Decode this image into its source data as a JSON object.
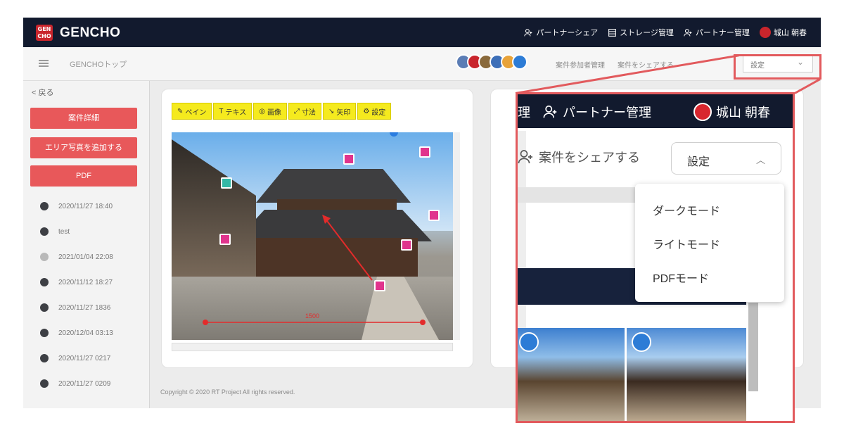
{
  "nav": {
    "logo_box": "GEN CHO",
    "logo_text": "GENCHO",
    "links": [
      {
        "label": "パートナーシェア",
        "icon": "person-add-icon"
      },
      {
        "label": "ストレージ管理",
        "icon": "storage-icon"
      },
      {
        "label": "パートナー管理",
        "icon": "person-add-icon"
      },
      {
        "label": "城山 朝春",
        "icon": "avatar"
      }
    ]
  },
  "subheader": {
    "breadcrumb": "GENCHOトップ",
    "action_participants": "案件参加者管理",
    "action_share": "案件をシェアする",
    "settings_value": "設定"
  },
  "sidebar": {
    "back": "< 戻る",
    "buttons": [
      "案件詳細",
      "エリア写真を追加する",
      "PDF"
    ],
    "items": [
      "2020/11/27 18:40",
      "test",
      "2021/01/04 22:08",
      "2020/11/12 18:27",
      "2020/11/27 1836",
      "2020/12/04 03:13",
      "2020/11/27 0217",
      "2020/11/27 0209"
    ]
  },
  "toolbar": {
    "items": [
      {
        "label": "ペイン",
        "icon": "pencil-icon"
      },
      {
        "label": "テキス",
        "icon": "text-icon"
      },
      {
        "label": "画像",
        "icon": "camera-icon"
      },
      {
        "label": "寸法",
        "icon": "ruler-icon"
      },
      {
        "label": "矢印",
        "icon": "arrow-icon"
      },
      {
        "label": "設定",
        "icon": "gear-icon"
      }
    ]
  },
  "canvas": {
    "dimension_label": "1500"
  },
  "footer": {
    "copyright": "Copyright © 2020 RT Project All rights reserved."
  },
  "zoom": {
    "nav_partner_prefix": "理",
    "nav_partner": "パートナー管理",
    "nav_user": "城山 朝春",
    "share": "案件をシェアする",
    "select_value": "設定",
    "menu": [
      "ダークモード",
      "ライトモード",
      "PDFモード"
    ]
  },
  "colors": {
    "nav_bg": "#121a2e",
    "accent_red": "#e8585a",
    "highlight": "#e25a5d",
    "toolbar_yellow": "#f5ea1e"
  }
}
